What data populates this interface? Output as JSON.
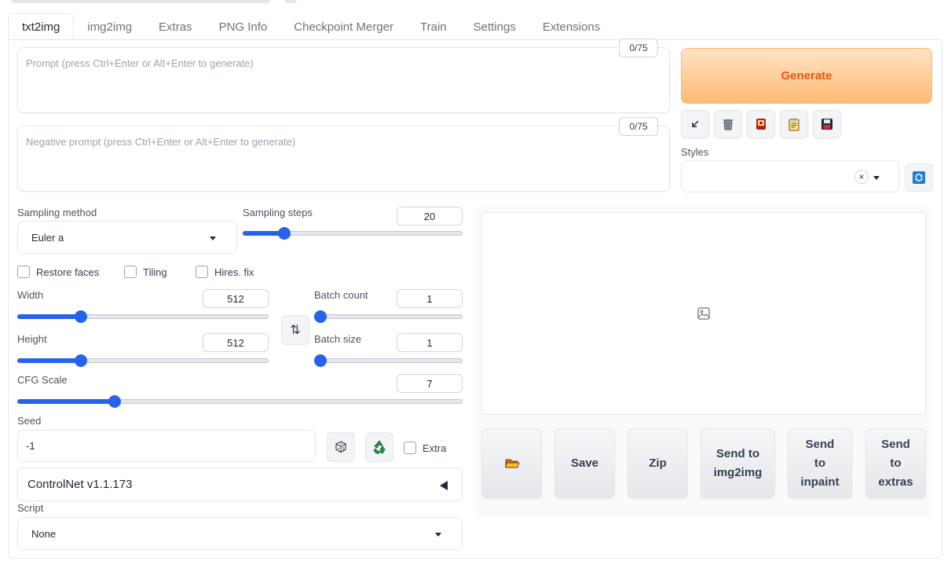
{
  "tabs": [
    "txt2img",
    "img2img",
    "Extras",
    "PNG Info",
    "Checkpoint Merger",
    "Train",
    "Settings",
    "Extensions"
  ],
  "prompt": {
    "placeholder": "Prompt (press Ctrl+Enter or Alt+Enter to generate)",
    "counter": "0/75"
  },
  "negative_prompt": {
    "placeholder": "Negative prompt (press Ctrl+Enter or Alt+Enter to generate)",
    "counter": "0/75"
  },
  "generate_label": "Generate",
  "tools": [
    "arrow-icon",
    "trash-icon",
    "card-icon",
    "clipboard-icon",
    "floppy-icon"
  ],
  "styles": {
    "label": "Styles",
    "clear": "×"
  },
  "sampling": {
    "method_label": "Sampling method",
    "method_value": "Euler a",
    "steps_label": "Sampling steps",
    "steps_value": "20",
    "steps_fraction": 0.17
  },
  "checkboxes": {
    "restore_faces": "Restore faces",
    "tiling": "Tiling",
    "hires_fix": "Hires. fix"
  },
  "width": {
    "label": "Width",
    "value": "512",
    "fraction": 0.24
  },
  "height": {
    "label": "Height",
    "value": "512",
    "fraction": 0.24
  },
  "batch_count": {
    "label": "Batch count",
    "value": "1",
    "fraction": 0.0
  },
  "batch_size": {
    "label": "Batch size",
    "value": "1",
    "fraction": 0.0
  },
  "cfg": {
    "label": "CFG Scale",
    "value": "7",
    "fraction": 0.21
  },
  "swap_glyph": "⇅",
  "seed": {
    "label": "Seed",
    "value": "-1",
    "extra_label": "Extra"
  },
  "controlnet_label": "ControlNet v1.1.173",
  "script": {
    "label": "Script",
    "value": "None"
  },
  "output_buttons": {
    "save": "Save",
    "zip": "Zip",
    "send_img2img_1": "Send to",
    "send_img2img_2": "img2img",
    "send_inpaint_1": "Send",
    "send_inpaint_2": "to",
    "send_inpaint_3": "inpaint",
    "send_extras_1": "Send",
    "send_extras_2": "to",
    "send_extras_3": "extras"
  }
}
